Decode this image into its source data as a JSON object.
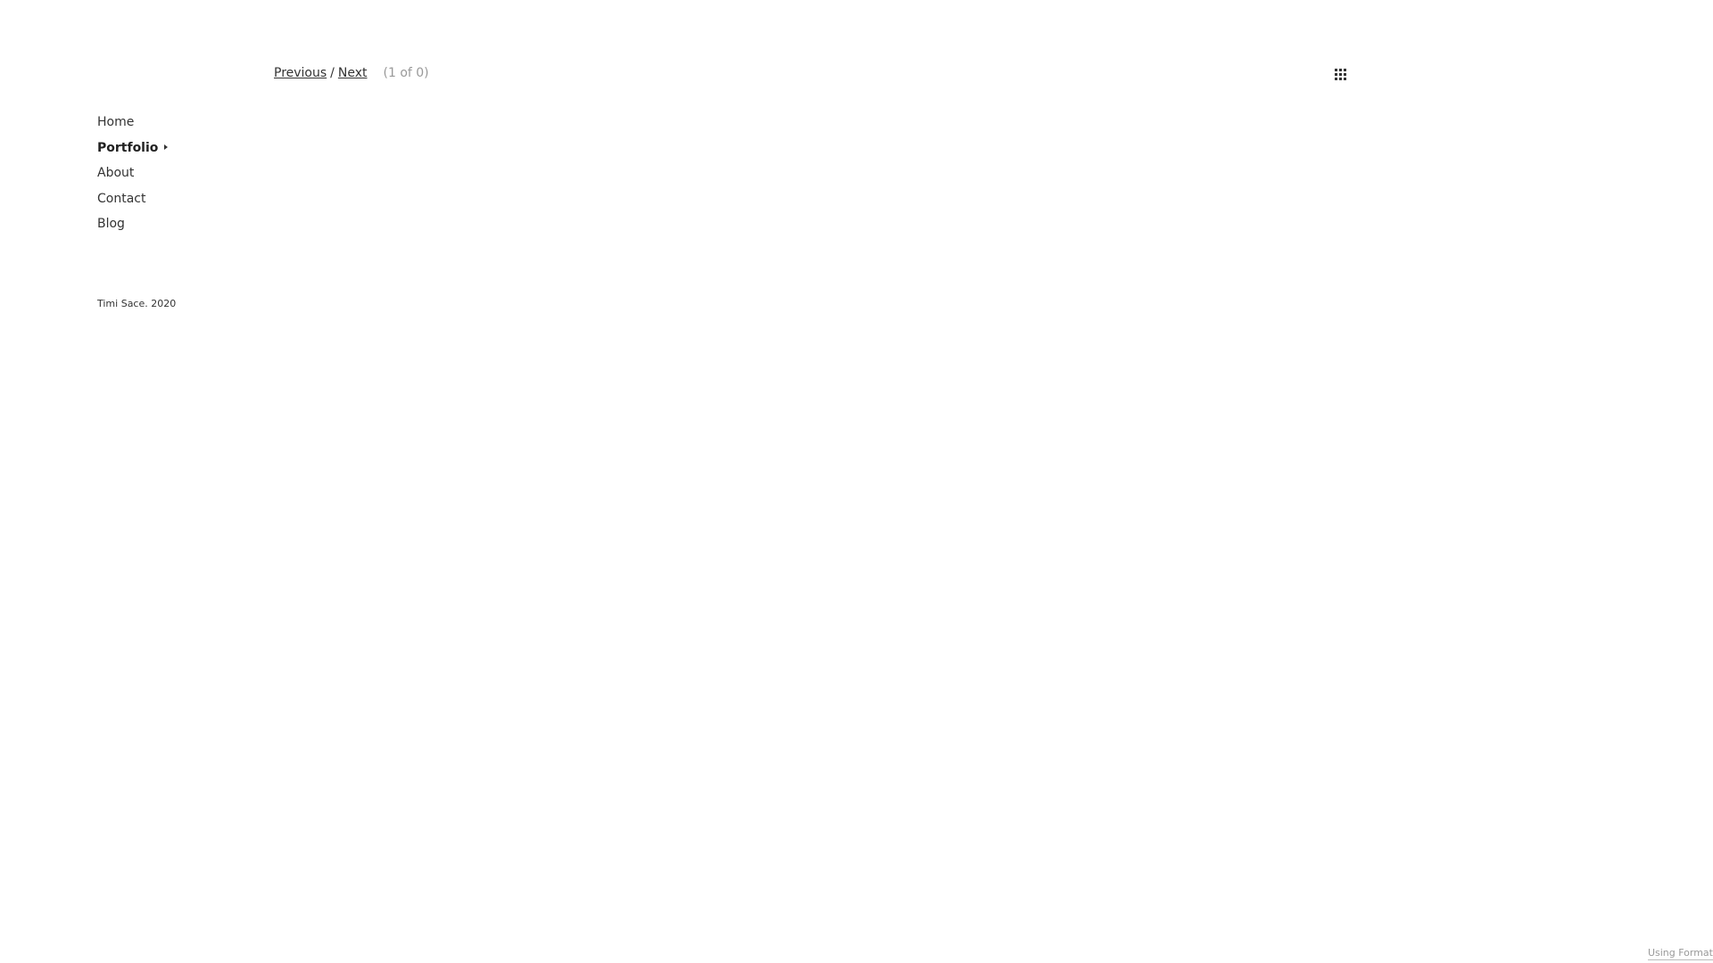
{
  "nav": {
    "items": [
      {
        "label": "Home",
        "active": false
      },
      {
        "label": "Portfolio",
        "active": true,
        "has_caret": true
      },
      {
        "label": "About",
        "active": false
      },
      {
        "label": "Contact",
        "active": false
      },
      {
        "label": "Blog",
        "active": false
      }
    ]
  },
  "footer": {
    "copyright": "Timi Sace. 2020"
  },
  "pager": {
    "previous_label": "Previous",
    "separator": "/",
    "next_label": "Next",
    "count_text": "(1 of 0)"
  },
  "icons": {
    "grid": "grid-icon"
  },
  "badge": {
    "label": "Using Format"
  },
  "colors": {
    "text": "#333333",
    "muted": "#999999",
    "background": "#ffffff"
  }
}
